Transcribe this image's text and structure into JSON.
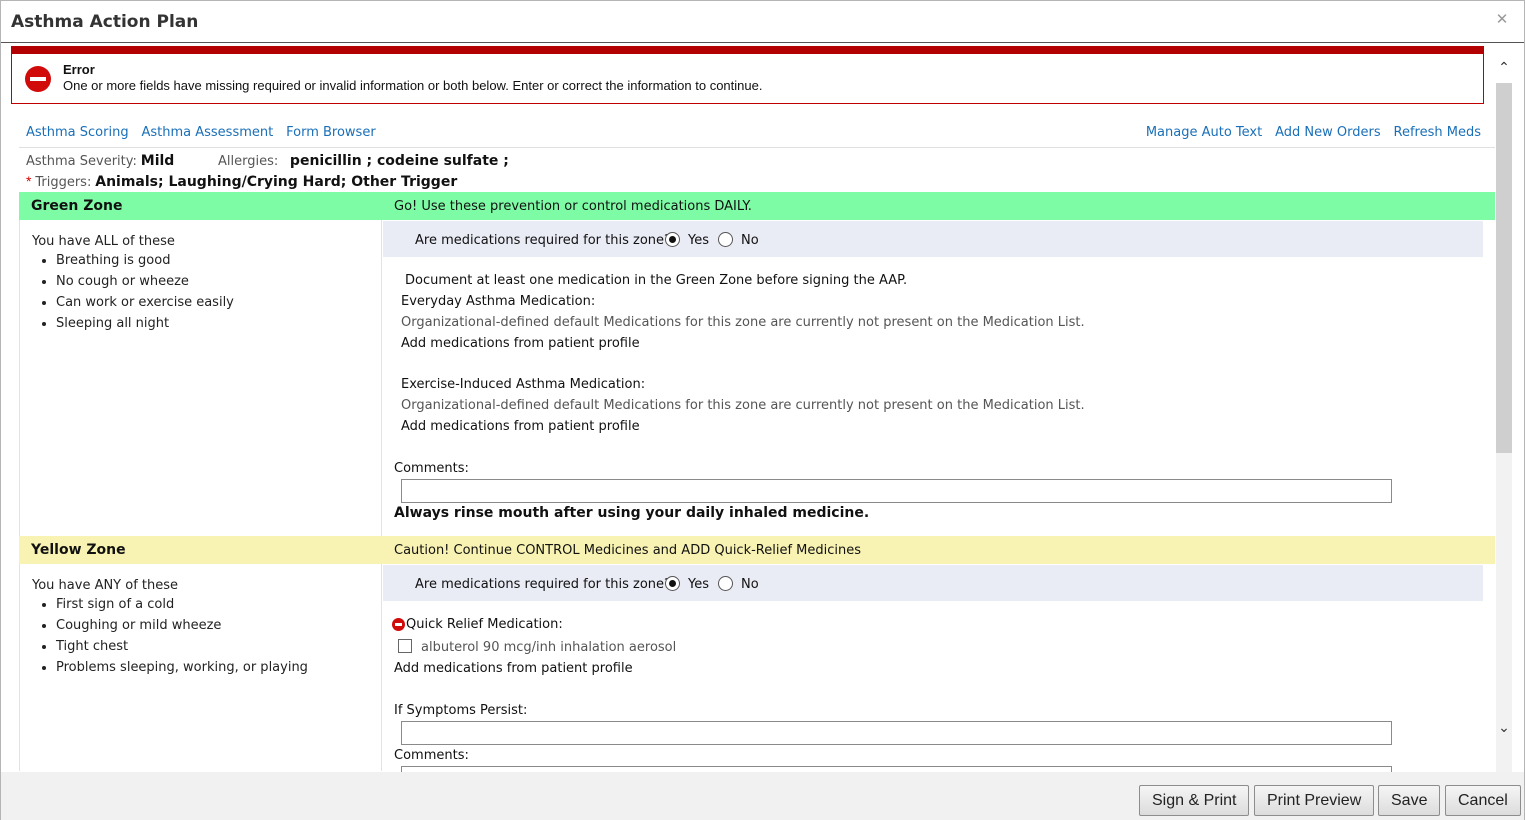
{
  "window": {
    "title": "Asthma Action Plan",
    "close_icon": "close-icon"
  },
  "error": {
    "title": "Error",
    "message": "One or more fields have missing required or invalid information or both below. Enter or correct the information to continue.",
    "icon": "error-stop-icon",
    "color": "#b30000"
  },
  "top_links_left": [
    "Asthma Scoring",
    "Asthma Assessment",
    "Form Browser"
  ],
  "top_links_right": [
    "Manage Auto Text",
    "Add New Orders",
    "Refresh Meds"
  ],
  "info": {
    "severity_label": "Asthma Severity:",
    "severity_value": "Mild",
    "allergies_label": "Allergies:",
    "allergies_value": "penicillin ; codeine sulfate ;",
    "triggers_label": "Triggers:",
    "triggers_value": "Animals;  Laughing/Crying Hard;  Other Trigger",
    "required_mark": "*"
  },
  "green_zone": {
    "name": "Green Zone",
    "message": "Go! Use these prevention or control medications DAILY.",
    "color": "#7dfca5",
    "lead": "You have ALL of these",
    "items": [
      "Breathing is good",
      "No cough or wheeze",
      "Can work or exercise easily",
      "Sleeping all night"
    ],
    "question": "Are medications required for this zone?",
    "yes": "Yes",
    "no": "No",
    "selected": "Yes",
    "doc_note": "Document at least one medication in the Green Zone before signing the AAP.",
    "everyday_label": "Everyday Asthma Medication:",
    "everyday_note": "Organizational-defined default Medications for this zone are currently not present on the Medication List.",
    "everyday_link": "Add medications from patient profile",
    "exercise_label": "Exercise-Induced Asthma Medication:",
    "exercise_note": "Organizational-defined default Medications for this zone are currently not present on the Medication List.",
    "exercise_link": "Add medications from patient profile",
    "comments_label": "Comments:",
    "comments_value": "",
    "rinse_note": "Always rinse mouth after using your daily inhaled medicine."
  },
  "yellow_zone": {
    "name": "Yellow Zone",
    "message": "Caution! Continue CONTROL Medicines and ADD Quick-Relief Medicines",
    "color": "#f8f3b2",
    "lead": "You have ANY of these",
    "items": [
      "First sign of a cold",
      "Coughing or mild wheeze",
      "Tight chest",
      "Problems sleeping, working, or playing"
    ],
    "question": "Are medications required for this zone?",
    "yes": "Yes",
    "no": "No",
    "selected": "Yes",
    "quick_relief_label": "Quick Relief Medication:",
    "medication": "albuterol 90 mcg/inh inhalation aerosol",
    "medication_checked": false,
    "add_link": "Add medications from patient profile",
    "persist_label": "If Symptoms Persist:",
    "persist_value": "",
    "comments_label": "Comments:"
  },
  "footer": {
    "buttons": [
      "Sign & Print",
      "Print Preview",
      "Save",
      "Cancel"
    ]
  }
}
